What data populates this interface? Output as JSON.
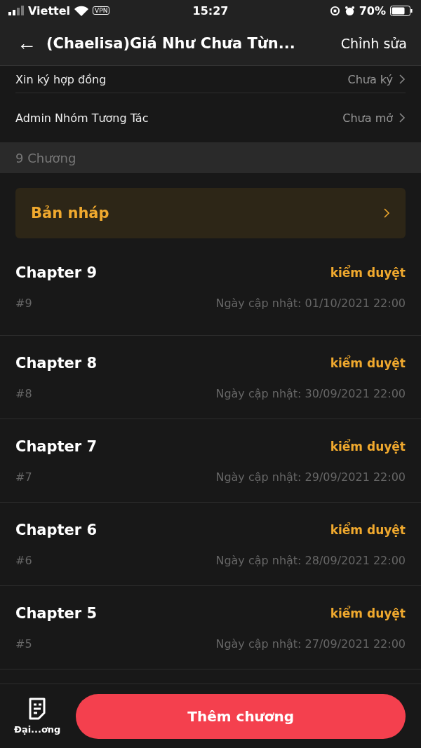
{
  "status_bar": {
    "carrier": "Viettel",
    "vpn": "VPN",
    "time": "15:27",
    "battery": "70%"
  },
  "header": {
    "back": "←",
    "title": "(Chaelisa)Giá Như Chưa Từn...",
    "action": "Chỉnh sửa"
  },
  "settings": [
    {
      "label": "Xin ký hợp đồng",
      "value": "Chưa ký"
    },
    {
      "label": "Admin Nhóm Tương Tác",
      "value": "Chưa mở"
    }
  ],
  "section_title": "9 Chương",
  "draft": {
    "label": "Bản nháp"
  },
  "chapters": [
    {
      "title": "Chapter 9",
      "status": "kiểm duyệt",
      "number": "#9",
      "updated": "Ngày cập nhật: 01/10/2021 22:00"
    },
    {
      "title": "Chapter 8",
      "status": "kiểm duyệt",
      "number": "#8",
      "updated": "Ngày cập nhật: 30/09/2021 22:00"
    },
    {
      "title": "Chapter 7",
      "status": "kiểm duyệt",
      "number": "#7",
      "updated": "Ngày cập nhật: 29/09/2021 22:00"
    },
    {
      "title": "Chapter 6",
      "status": "kiểm duyệt",
      "number": "#6",
      "updated": "Ngày cập nhật: 28/09/2021 22:00"
    },
    {
      "title": "Chapter 5",
      "status": "kiểm duyệt",
      "number": "#5",
      "updated": "Ngày cập nhật: 27/09/2021 22:00"
    }
  ],
  "bottom_bar": {
    "outline_label": "Đại...ơng",
    "add_button": "Thêm chương"
  }
}
